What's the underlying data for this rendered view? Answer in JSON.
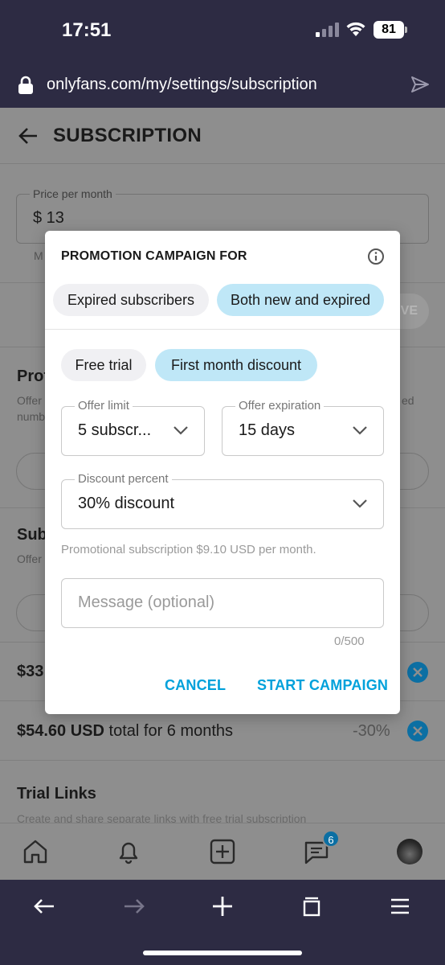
{
  "status_bar": {
    "time": "17:51",
    "battery": "81"
  },
  "browser": {
    "url": "onlyfans.com/my/settings/subscription"
  },
  "page": {
    "title": "SUBSCRIPTION",
    "price_label": "Price per month",
    "price_value": "$ 13",
    "partial_left_text": "M",
    "save_label": "VE",
    "section_promo_title": "Prof",
    "section_promo_desc_1": "Offer",
    "section_promo_desc_2": "numb",
    "section_promo_desc_right": "ed",
    "section_bundles_title": "Sub",
    "section_bundles_desc": "Offer",
    "bundle_rows": [
      {
        "text": "$33",
        "percent": ""
      },
      {
        "text_bold": "$54.60 USD",
        "text_rest": " total for 6 months",
        "percent": "-30%"
      }
    ],
    "trial_links_title": "Trial Links",
    "trial_links_desc": "Create and share separate links with free trial subscription"
  },
  "bottom_nav": {
    "messages_badge": "6"
  },
  "modal": {
    "title": "PROMOTION CAMPAIGN FOR",
    "audience_options": [
      {
        "label": "Expired subscribers",
        "selected": false
      },
      {
        "label": "Both new and expired",
        "selected": true
      }
    ],
    "type_options": [
      {
        "label": "Free trial",
        "selected": false
      },
      {
        "label": "First month discount",
        "selected": true
      }
    ],
    "offer_limit": {
      "label": "Offer limit",
      "value": "5 subscr..."
    },
    "offer_expiration": {
      "label": "Offer expiration",
      "value": "15 days"
    },
    "discount_percent": {
      "label": "Discount percent",
      "value": "30% discount"
    },
    "hint": "Promotional subscription $9.10 USD per month.",
    "message_placeholder": "Message (optional)",
    "counter": "0/500",
    "cancel_label": "CANCEL",
    "start_label": "START CAMPAIGN"
  },
  "colors": {
    "accent": "#00a1db",
    "chip_selected": "#bfe7f7",
    "browser_chrome": "#2d2b43"
  }
}
